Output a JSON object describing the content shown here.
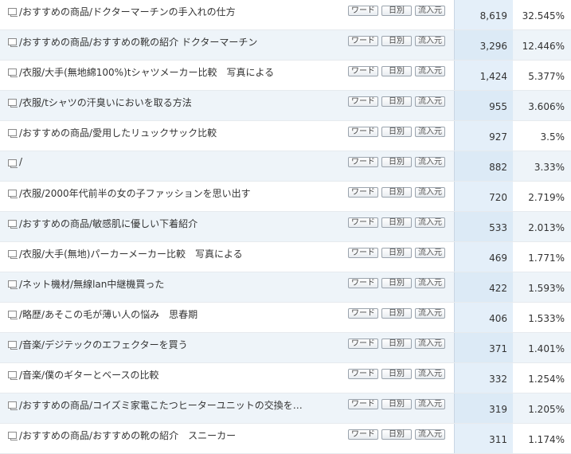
{
  "buttons": {
    "word": "ワード",
    "daily": "日別",
    "source": "流入元"
  },
  "rows": [
    {
      "page": "/おすすめの商品/ドクターマーチンの手入れの仕方",
      "count": "8,619",
      "percent": "32.545%"
    },
    {
      "page": "/おすすめの商品/おすすめの靴の紹介 ドクターマーチン",
      "count": "3,296",
      "percent": "12.446%"
    },
    {
      "page": "/衣服/大手(無地綿100%)tシャツメーカー比較　写真による",
      "count": "1,424",
      "percent": "5.377%"
    },
    {
      "page": "/衣服/tシャツの汗臭いにおいを取る方法",
      "count": "955",
      "percent": "3.606%"
    },
    {
      "page": "/おすすめの商品/愛用したリュックサック比較",
      "count": "927",
      "percent": "3.5%"
    },
    {
      "page": "/",
      "count": "882",
      "percent": "3.33%"
    },
    {
      "page": "/衣服/2000年代前半の女の子ファッションを思い出す",
      "count": "720",
      "percent": "2.719%"
    },
    {
      "page": "/おすすめの商品/敏感肌に優しい下着紹介",
      "count": "533",
      "percent": "2.013%"
    },
    {
      "page": "/衣服/大手(無地)パーカーメーカー比較　写真による",
      "count": "469",
      "percent": "1.771%"
    },
    {
      "page": "/ネット機材/無線lan中継機買った",
      "count": "422",
      "percent": "1.593%"
    },
    {
      "page": "/略歴/あそこの毛が薄い人の悩み　思春期",
      "count": "406",
      "percent": "1.533%"
    },
    {
      "page": "/音楽/デジテックのエフェクターを買う",
      "count": "371",
      "percent": "1.401%"
    },
    {
      "page": "/音楽/僕のギターとベースの比較",
      "count": "332",
      "percent": "1.254%"
    },
    {
      "page": "/おすすめの商品/コイズミ家電こたつヒーターユニットの交換を…",
      "count": "319",
      "percent": "1.205%"
    },
    {
      "page": "/おすすめの商品/おすすめの靴の紹介　スニーカー",
      "count": "311",
      "percent": "1.174%"
    }
  ]
}
